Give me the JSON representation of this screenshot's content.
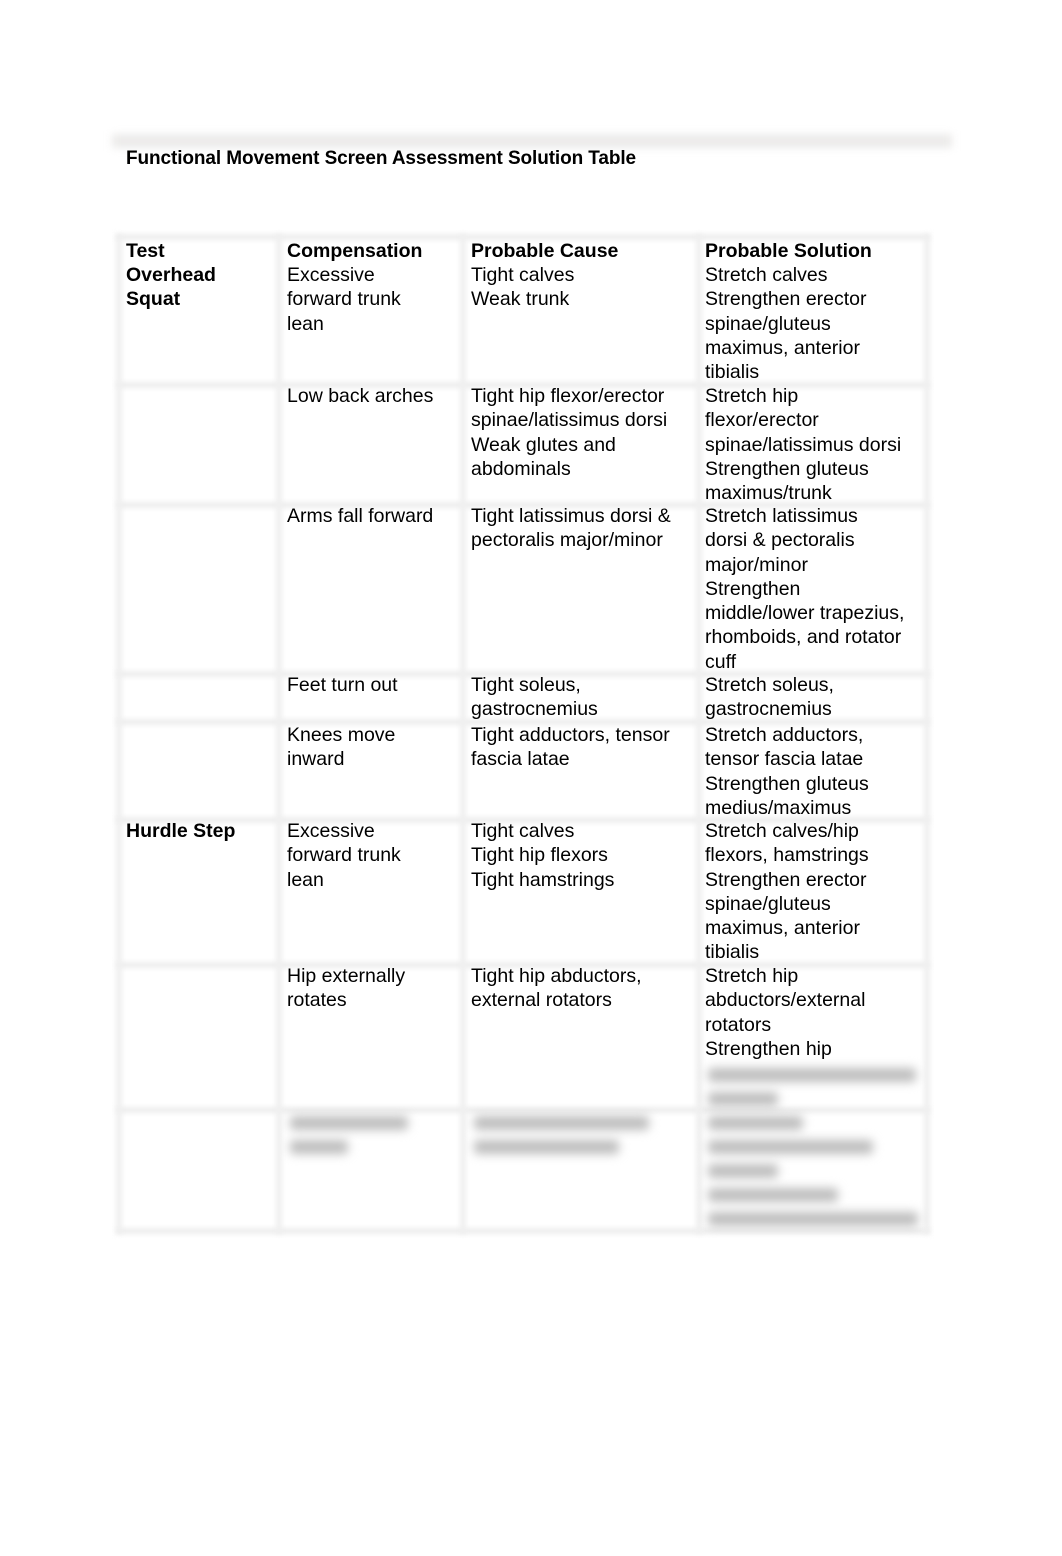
{
  "document": {
    "title": "Functional Movement Screen Assessment Solution Table",
    "table": {
      "headers": [
        "Test",
        "Compensation",
        "Probable Cause",
        "Probable Solution"
      ],
      "rows": [
        {
          "test": "Overhead\nSquat",
          "compensation": "Excessive\nforward trunk\nlean",
          "cause": "Tight calves\nWeak trunk",
          "solution": "Stretch calves\nStrengthen erector\nspinae/gluteus\nmaximus, anterior\ntibialis"
        },
        {
          "test": "",
          "compensation": "Low back arches",
          "cause": "Tight hip flexor/erector\nspinae/latissimus dorsi\nWeak glutes and\nabdominals",
          "solution": "Stretch hip\nflexor/erector\nspinae/latissimus dorsi\nStrengthen gluteus\nmaximus/trunk"
        },
        {
          "test": "",
          "compensation": "Arms fall forward",
          "cause": "Tight latissimus dorsi &\npectoralis major/minor",
          "solution": "Stretch latissimus\ndorsi & pectoralis\nmajor/minor\nStrengthen\nmiddle/lower trapezius,\nrhomboids, and rotator\ncuff"
        },
        {
          "test": "",
          "compensation": "Feet turn out",
          "cause": "Tight soleus,\ngastrocnemius",
          "solution": "Stretch soleus,\ngastrocnemius"
        },
        {
          "test": "",
          "compensation": "Knees move\ninward",
          "cause": "Tight adductors, tensor\nfascia latae",
          "solution": "Stretch adductors,\ntensor fascia latae\nStrengthen gluteus\nmedius/maximus"
        },
        {
          "test": "Hurdle Step",
          "compensation": "Excessive\nforward trunk\nlean",
          "cause": "Tight calves\nTight hip flexors\nTight hamstrings",
          "solution": "Stretch calves/hip\nflexors, hamstrings\nStrengthen erector\nspinae/gluteus\nmaximus, anterior\ntibialis"
        },
        {
          "test": "",
          "compensation": "Hip externally\nrotates",
          "cause": "Tight hip abductors,\nexternal rotators",
          "solution": "Stretch hip\nabductors/external\nrotators\nStrengthen hip"
        }
      ]
    }
  }
}
